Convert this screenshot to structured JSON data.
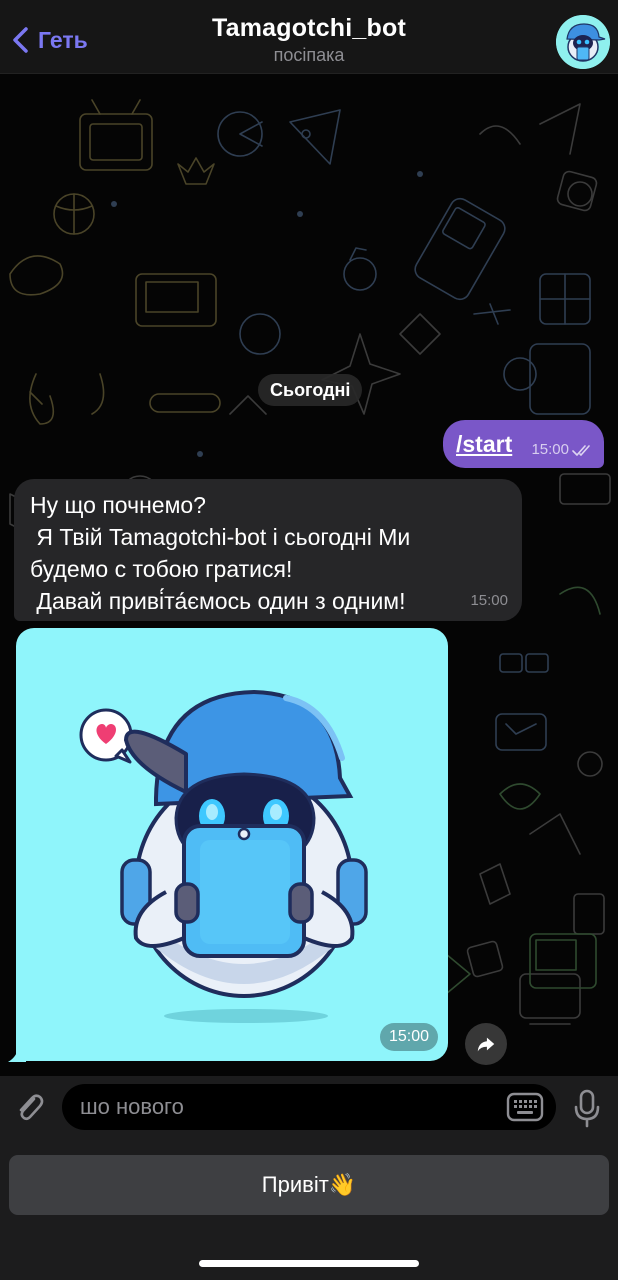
{
  "header": {
    "back_label": "Геть",
    "title": "Tamagotchi_bot",
    "subtitle": "посіпака"
  },
  "chat": {
    "date_separator": "Сьогодні",
    "messages": [
      {
        "direction": "outgoing",
        "text": "/start",
        "time": "15:00",
        "status": "read"
      },
      {
        "direction": "incoming",
        "text": "Ну що почнемо?\n Я Твій Tamagotchi-bot і сьогодні Ми\nбудемо с тобою гратися!\n Давай приві́та́ємось один з одним!",
        "time": "15:00"
      },
      {
        "direction": "incoming",
        "type": "photo",
        "sticker_icon": "heart-icon",
        "time": "15:00"
      }
    ]
  },
  "composer": {
    "placeholder": "шо нового"
  },
  "reply_keyboard": {
    "buttons": [
      "Привіт👋"
    ]
  },
  "colors": {
    "accent": "#7b78f2",
    "outgoing_bubble": "#7a57c8",
    "incoming_bubble": "#262628",
    "photo_background": "#8ff5fb",
    "reply_button": "#3e3f42"
  }
}
